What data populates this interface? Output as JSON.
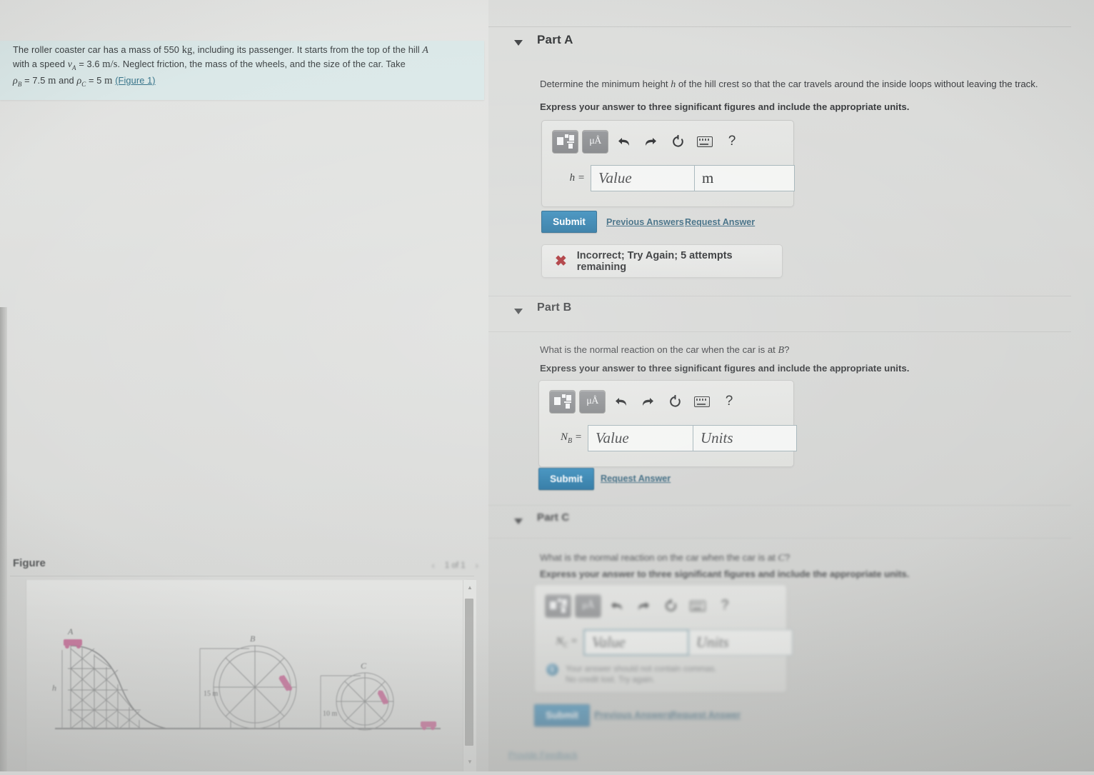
{
  "problem": {
    "text_line1_a": "The roller coaster car has a mass of 550",
    "text_unit_kg": "kg",
    "text_line1_b": ", including its passenger. It starts from the top of the hill",
    "hill_label": "A",
    "text_line2_a": "with a speed",
    "speed_var": "v",
    "speed_sub": "A",
    "speed_eq": "= 3.6",
    "speed_unit": "m/s",
    "text_line2_b": ". Neglect friction, the mass of the wheels, and the size of the car. Take",
    "rho_b_var": "ρ",
    "rho_b_sub": "B",
    "rho_b_eq": "= 7.5",
    "rho_b_unit": "m",
    "and_word": "and",
    "rho_c_var": "ρ",
    "rho_c_sub": "C",
    "rho_c_eq": "= 5",
    "rho_c_unit": "m",
    "figure_link": "(Figure 1)",
    "highlight_color": "#d9e7e7"
  },
  "figure_panel": {
    "title": "Figure",
    "prev_arrow": "‹",
    "pager": "1 of 1",
    "next_arrow": "›",
    "scroll_up": "▲",
    "scroll_down": "▼",
    "diagram": {
      "label_h": "h",
      "label_a": "A",
      "label_b": "B",
      "label_c": "C",
      "dim_b": "15 m",
      "dim_c": "10 m"
    }
  },
  "parts": [
    {
      "id": "part-a",
      "label": "Part A",
      "caret": "▼",
      "question": "Determine the minimum height h of the hill crest so that the car travels around the inside loops without leaving the track.",
      "question_pre": "Determine the minimum height",
      "question_var": "h",
      "question_post": "of the hill crest so that the car travels around the inside loops without leaving the track.",
      "instruction": "Express your answer to three significant figures and include the appropriate units.",
      "field_label": "h",
      "field_sub": "",
      "field_eq": "=",
      "value_text": "Value",
      "units_text": "m",
      "units_filled": true,
      "submit_label": "Submit",
      "links": [
        "Previous Answers",
        "Request Answer"
      ],
      "feedback": {
        "icon": "✖",
        "text": "Incorrect; Try Again; 5 attempts remaining"
      }
    },
    {
      "id": "part-b",
      "label": "Part B",
      "caret": "▼",
      "question_pre": "What is the normal reaction on the car when the car is at",
      "question_var": "B",
      "question_post": "?",
      "instruction": "Express your answer to three significant figures and include the appropriate units.",
      "field_label": "N",
      "field_sub": "B",
      "field_eq": "=",
      "value_text": "Value",
      "units_text": "Units",
      "units_filled": false,
      "submit_label": "Submit",
      "links": [
        "Request Answer"
      ],
      "feedback": null
    },
    {
      "id": "part-c",
      "label": "Part C",
      "caret": "▼",
      "question_pre": "What is the normal reaction on the car when the car is at",
      "question_var": "C",
      "question_post": "?",
      "instruction": "Express your answer to three significant figures and include the appropriate units.",
      "field_label": "N",
      "field_sub": "C",
      "field_eq": "=",
      "value_text": "Value",
      "units_text": "Units",
      "units_filled": false,
      "submit_label": "Submit",
      "links": [
        "Previous Answers",
        "Request Answer"
      ],
      "note": {
        "icon": "i",
        "line1": "Your answer should not contain commas.",
        "line2": "No credit lost. Try again."
      }
    }
  ],
  "toolbar": {
    "template_icon": "math-template-icon",
    "units_label": "μÅ",
    "undo": "↰",
    "redo": "↱",
    "reset": "↻",
    "keyboard": "keyboard-icon",
    "help": "?"
  },
  "footer": {
    "provide_feedback": "Provide Feedback"
  },
  "colors": {
    "accent_blue": "#2e86b8",
    "link_blue": "#2f5f78",
    "error_red": "#a42127",
    "highlight": "#d9e7e7",
    "page_bg": "#d2d3d2"
  }
}
